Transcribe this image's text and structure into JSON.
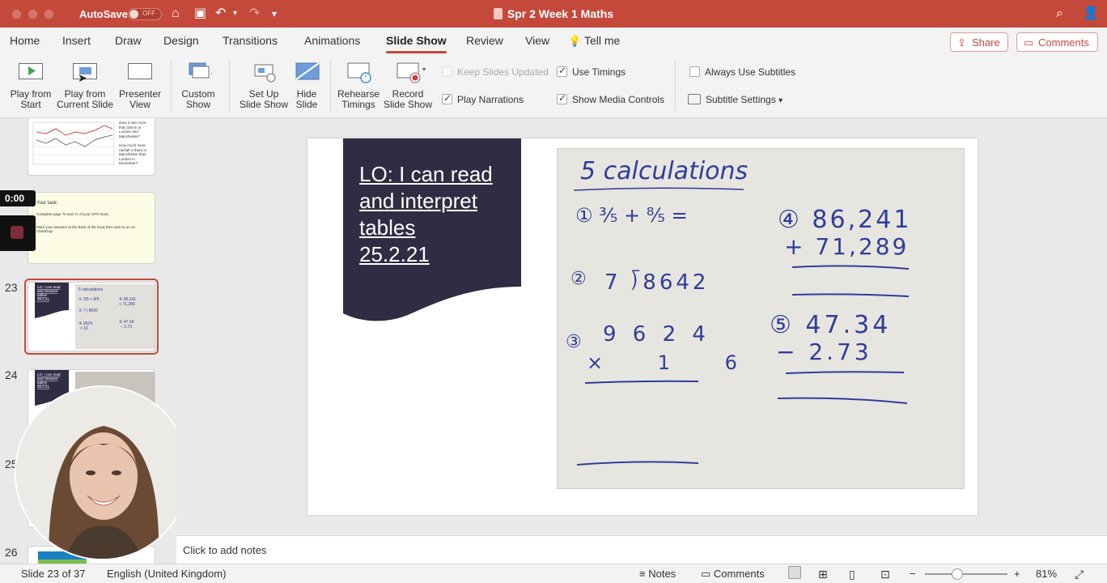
{
  "titlebar": {
    "autosave_label": "AutoSave",
    "autosave_state": "OFF",
    "document_title": "Spr 2 Week 1 Maths"
  },
  "tabs": [
    {
      "label": "Home"
    },
    {
      "label": "Insert"
    },
    {
      "label": "Draw"
    },
    {
      "label": "Design"
    },
    {
      "label": "Transitions"
    },
    {
      "label": "Animations"
    },
    {
      "label": "Slide Show",
      "active": true
    },
    {
      "label": "Review"
    },
    {
      "label": "View"
    },
    {
      "label": "Tell me"
    }
  ],
  "actions": {
    "share": "Share",
    "comments": "Comments"
  },
  "ribbon": {
    "play_from_start": [
      "Play from",
      "Start"
    ],
    "play_from_current": [
      "Play from",
      "Current Slide"
    ],
    "presenter_view": [
      "Presenter",
      "View"
    ],
    "custom_show": [
      "Custom",
      "Show"
    ],
    "setup_show": [
      "Set Up",
      "Slide Show"
    ],
    "hide_slide": [
      "Hide",
      "Slide"
    ],
    "rehearse": [
      "Rehearse",
      "Timings"
    ],
    "record": [
      "Record",
      "Slide Show"
    ],
    "keep_updated": "Keep Slides Updated",
    "use_timings": "Use Timings",
    "play_narrations": "Play Narrations",
    "show_media_controls": "Show Media Controls",
    "always_subtitles": "Always Use Subtitles",
    "subtitle_settings": "Subtitle Settings"
  },
  "slidepane": {
    "timer": "0:00",
    "numbers": {
      "s23": "23",
      "s24": "24",
      "s25": "25",
      "s26": "26"
    },
    "thumb_task": {
      "title": "Your task:",
      "line1": "Complete page 70 and 71 of your CPG book.",
      "line2": "Mark your answers at the back of the book then sent to us on ClassDojo"
    },
    "thumb_top_text": [
      "does it rain more",
      "than 50mm in",
      "London and",
      "Manchester?",
      "How much more",
      "rainfall is there in",
      "Manchester than",
      "London in",
      "December?"
    ]
  },
  "slide": {
    "lo_lines": [
      "LO: I can read",
      "and interpret",
      "tables",
      "25.2.21"
    ],
    "board": {
      "heading": "5 calculations",
      "q1": "① ³⁄₅ + ⁸⁄₅ =",
      "q2_num": "②",
      "q2": "7 ⟌8642",
      "q3_num": "③",
      "q3_top": "9 6 2 4",
      "q3_bottom": "× 1 6",
      "q4_top": "④ 86,241",
      "q4_bottom": "+ 71,289",
      "q5_top": "⑤ 47.34",
      "q5_bottom": "− 2.73"
    }
  },
  "notes": {
    "placeholder": "Click to add notes"
  },
  "status": {
    "slide_counter": "Slide 23 of 37",
    "language": "English (United Kingdom)",
    "notes": "Notes",
    "comments": "Comments",
    "zoom": "81%",
    "zoom_fraction": 0.39
  }
}
